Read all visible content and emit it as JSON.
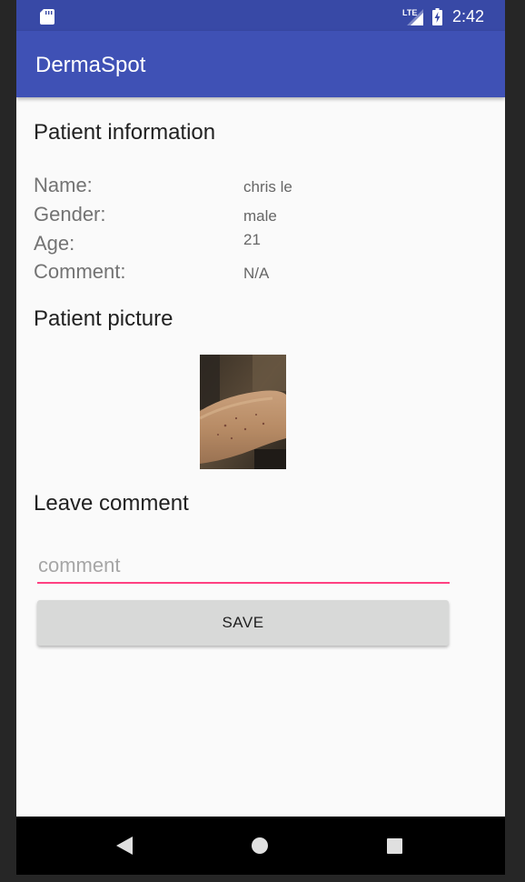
{
  "status_bar": {
    "network": "LTE",
    "time": "2:42",
    "icons": [
      "sd-card-icon",
      "signal-icon",
      "battery-charging-icon"
    ]
  },
  "app_bar": {
    "title": "DermaSpot",
    "color": "#3f51b5"
  },
  "patient_info": {
    "heading": "Patient information",
    "fields": [
      {
        "label": "Name:",
        "value": "chris le"
      },
      {
        "label": "Gender:",
        "value": "male"
      },
      {
        "label": "Age:",
        "value": "21"
      },
      {
        "label": "Comment:",
        "value": "N/A"
      }
    ]
  },
  "patient_picture": {
    "heading": "Patient picture"
  },
  "leave_comment": {
    "heading": "Leave comment",
    "input_value": "",
    "input_placeholder": "comment",
    "save_label": "SAVE",
    "accent_color": "#ff4081"
  },
  "nav_bar": {
    "icons": [
      "back-icon",
      "home-icon",
      "recents-icon"
    ]
  }
}
